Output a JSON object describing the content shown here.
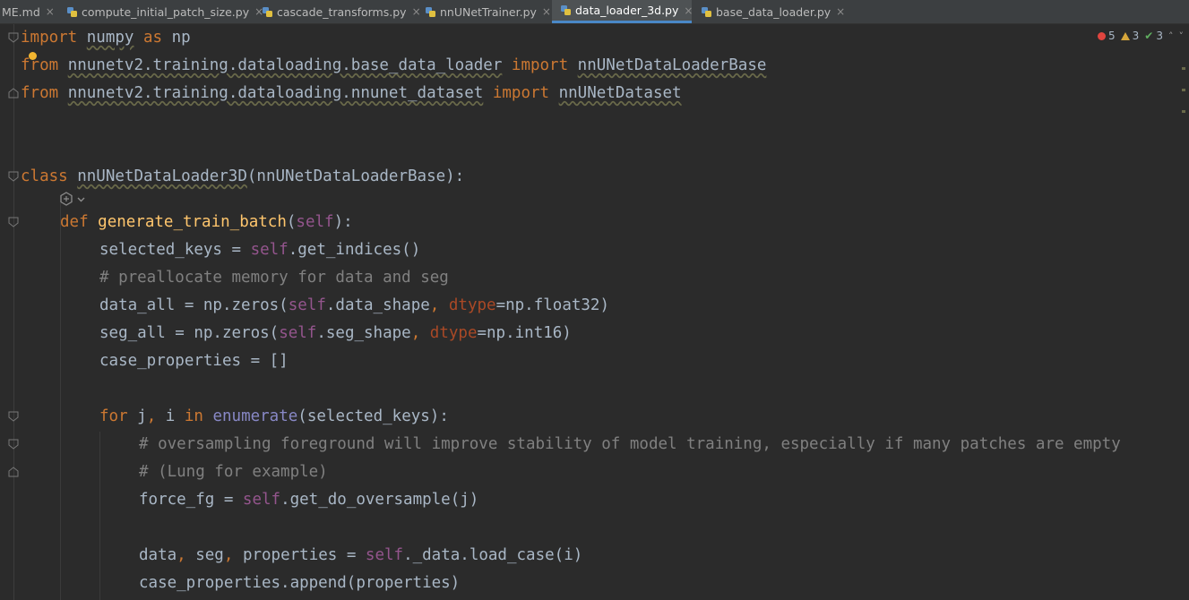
{
  "tabs": [
    {
      "label": "ME.md",
      "active": false,
      "has_icon": false
    },
    {
      "label": "compute_initial_patch_size.py",
      "active": false,
      "has_icon": true
    },
    {
      "label": "cascade_transforms.py",
      "active": false,
      "has_icon": true
    },
    {
      "label": "nnUNetTrainer.py",
      "active": false,
      "has_icon": true
    },
    {
      "label": "data_loader_3d.py",
      "active": true,
      "has_icon": true
    },
    {
      "label": "base_data_loader.py",
      "active": false,
      "has_icon": true
    }
  ],
  "tab_close_glyph": "×",
  "inspections": {
    "errors": "5",
    "warnings": "3",
    "weak_warnings": "3",
    "up": "˄",
    "down": "˅"
  },
  "icons": {
    "file": "python-file-icon",
    "error": "error-icon",
    "warning": "warning-icon",
    "check": "check-icon",
    "bulb": "lightbulb-icon",
    "ai": "ai-assistant-icon"
  },
  "code": {
    "l1": {
      "k": "import",
      "a": " ",
      "m": "numpy",
      "b": " ",
      "k2": "as",
      "c": " np"
    },
    "l2": {
      "k": "from",
      "a": " ",
      "m": "nnunetv2.training.dataloading.base_data_loader",
      "b": " ",
      "k2": "import",
      "c": " ",
      "n": "nnUNetDataLoaderBase"
    },
    "l3": {
      "k": "from",
      "a": " ",
      "m": "nnunetv2.training.dataloading.nnunet_dataset",
      "b": " ",
      "k2": "import",
      "c": " ",
      "n": "nnUNetDataset"
    },
    "l4": {
      "k": "class",
      "a": " ",
      "n": "nnUNetDataLoader3D",
      "c": "(nnUNetDataLoaderBase):"
    },
    "l5": {
      "k": "def",
      "a": " ",
      "f": "generate_train_batch",
      "p1": "(",
      "s": "self",
      "p2": "):"
    },
    "l6": {
      "a": "selected_keys = ",
      "s": "self",
      "c": ".get_indices()"
    },
    "l7": {
      "c": "# preallocate memory for data and seg"
    },
    "l8": {
      "a": "data_all = np.zeros(",
      "s": "self",
      "b": ".data_shape",
      "cm": ",",
      "sp": " ",
      "p": "dtype",
      "c": "=np.float32)"
    },
    "l9": {
      "a": "seg_all = np.zeros(",
      "s": "self",
      "b": ".seg_shape",
      "cm": ",",
      "sp": " ",
      "p": "dtype",
      "c": "=np.int16)"
    },
    "l10": {
      "a": "case_properties = []"
    },
    "l11": {
      "k": "for",
      "a": " j",
      "cm": ",",
      "b": " i ",
      "k2": "in",
      "sp": " ",
      "bi": "enumerate",
      "c": "(selected_keys):"
    },
    "l12": {
      "c": "# oversampling foreground will improve stability of model training, especially if many patches are empty"
    },
    "l13": {
      "c": "# (Lung for example)"
    },
    "l14": {
      "a": "force_fg = ",
      "s": "self",
      "c": ".get_do_oversample(j)"
    },
    "l15": {
      "a": "data",
      "cm1": ",",
      "b": " seg",
      "cm2": ",",
      "d": " properties = ",
      "s": "self",
      "c": "._data.load_case(i)"
    },
    "l16": {
      "a": "case_properties.append(properties)"
    }
  }
}
